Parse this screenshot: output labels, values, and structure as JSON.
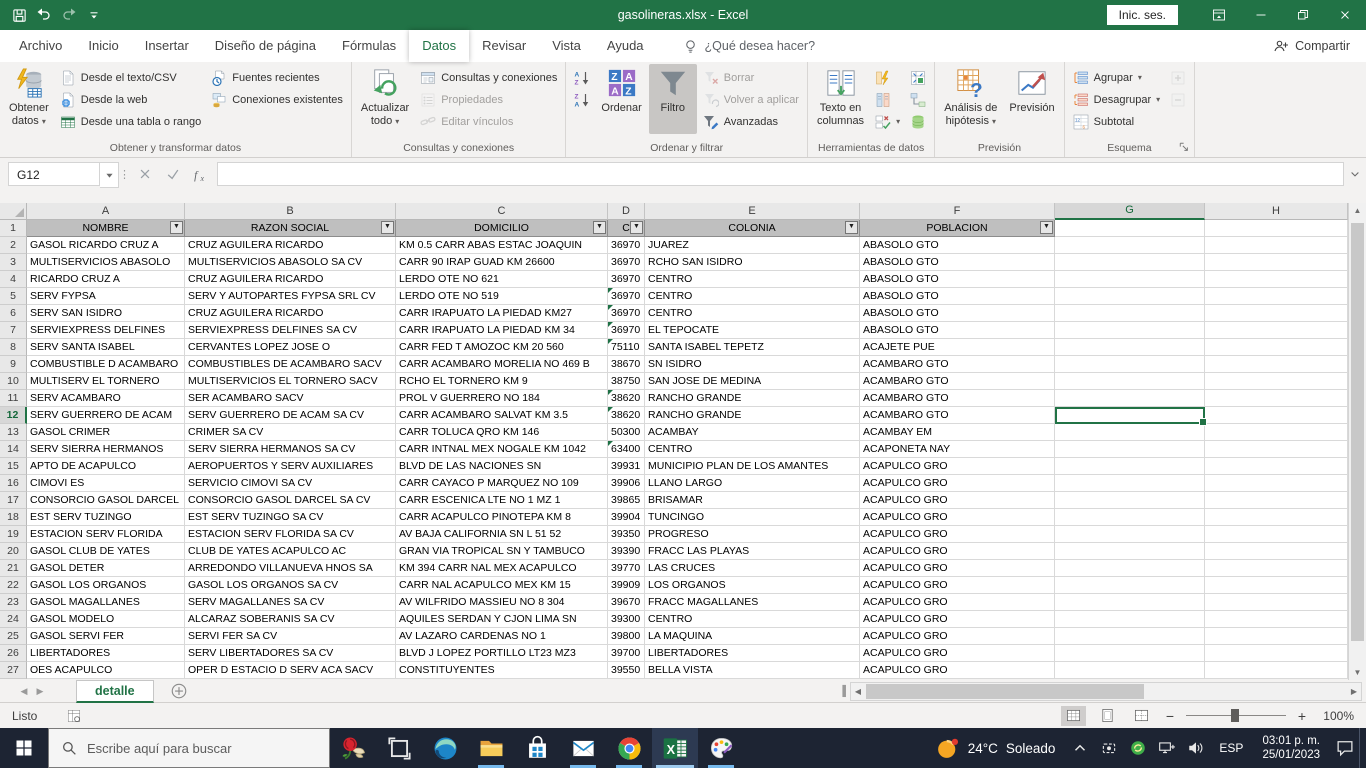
{
  "titlebar": {
    "title": "gasolineras.xlsx  -  Excel",
    "sign_in": "Inic. ses."
  },
  "menu": {
    "tabs": [
      "Archivo",
      "Inicio",
      "Insertar",
      "Diseño de página",
      "Fórmulas",
      "Datos",
      "Revisar",
      "Vista",
      "Ayuda"
    ],
    "active_tab": "Datos",
    "search_hint": "¿Qué desea hacer?",
    "share_label": "Compartir"
  },
  "ribbon": {
    "groups": [
      {
        "label": "Obtener y transformar datos",
        "cells": [
          {
            "type": "big",
            "lines": [
              "Obtener",
              "datos"
            ],
            "icon": "get-data-icon",
            "arrow": true
          },
          {
            "type": "stack",
            "items": [
              {
                "label": "Desde el texto/CSV",
                "icon": "from-text-csv-icon"
              },
              {
                "label": "Desde la web",
                "icon": "from-web-icon"
              },
              {
                "label": "Desde una tabla o rango",
                "icon": "from-table-icon"
              }
            ]
          },
          {
            "type": "stack",
            "items": [
              {
                "label": "Fuentes recientes",
                "icon": "recent-sources-icon"
              },
              {
                "label": "Conexiones existentes",
                "icon": "existing-connections-icon"
              }
            ]
          }
        ]
      },
      {
        "label": "Consultas y conexiones",
        "cells": [
          {
            "type": "big",
            "lines": [
              "Actualizar",
              "todo"
            ],
            "icon": "refresh-all-icon",
            "arrow": true
          },
          {
            "type": "stack",
            "items": [
              {
                "label": "Consultas y conexiones",
                "icon": "queries-connections-icon"
              },
              {
                "label": "Propiedades",
                "icon": "properties-icon",
                "disabled": true
              },
              {
                "label": "Editar vínculos",
                "icon": "edit-links-icon",
                "disabled": true
              }
            ]
          }
        ]
      },
      {
        "label": "Ordenar y filtrar",
        "cells": [
          {
            "type": "stack",
            "items": [
              {
                "label": "",
                "icon": "sort-az-icon"
              },
              {
                "label": "",
                "icon": "sort-za-icon"
              }
            ]
          },
          {
            "type": "big",
            "lines": [
              "Ordenar"
            ],
            "icon": "sort-dialog-icon"
          },
          {
            "type": "big",
            "lines": [
              "Filtro"
            ],
            "icon": "filter-icon",
            "active": true
          },
          {
            "type": "stack",
            "items": [
              {
                "label": "Borrar",
                "icon": "clear-filter-icon",
                "disabled": true
              },
              {
                "label": "Volver a aplicar",
                "icon": "reapply-filter-icon",
                "disabled": true
              },
              {
                "label": "Avanzadas",
                "icon": "advanced-filter-icon"
              }
            ]
          }
        ]
      },
      {
        "label": "Herramientas de datos",
        "cells": [
          {
            "type": "big",
            "lines": [
              "Texto en",
              "columnas"
            ],
            "icon": "text-to-columns-icon"
          },
          {
            "type": "stack",
            "items": [
              {
                "label": "",
                "icon": "flash-fill-icon"
              },
              {
                "label": "",
                "icon": "remove-duplicates-icon"
              },
              {
                "label": "",
                "icon": "data-validation-icon",
                "arrow": true
              }
            ]
          },
          {
            "type": "stack",
            "items": [
              {
                "label": "",
                "icon": "consolidate-icon"
              },
              {
                "label": "",
                "icon": "relationships-icon"
              },
              {
                "label": "",
                "icon": "data-model-icon"
              }
            ]
          }
        ]
      },
      {
        "label": "Previsión",
        "cells": [
          {
            "type": "big",
            "lines": [
              "Análisis de",
              "hipótesis"
            ],
            "icon": "what-if-icon",
            "arrow": true
          },
          {
            "type": "big",
            "lines": [
              "Previsión"
            ],
            "icon": "forecast-sheet-icon"
          }
        ]
      },
      {
        "label": "Esquema",
        "launcher": true,
        "cells": [
          {
            "type": "stack",
            "items": [
              {
                "label": "Agrupar",
                "icon": "group-icon",
                "arrow": true
              },
              {
                "label": "Desagrupar",
                "icon": "ungroup-icon",
                "arrow": true
              },
              {
                "label": "Subtotal",
                "icon": "subtotal-icon"
              }
            ]
          },
          {
            "type": "stack",
            "items": [
              {
                "label": "",
                "icon": "show-detail-icon",
                "disabled": true
              },
              {
                "label": "",
                "icon": "hide-detail-icon",
                "disabled": true
              }
            ]
          }
        ]
      }
    ]
  },
  "formula_bar": {
    "name_box": "G12",
    "formula": ""
  },
  "grid": {
    "columns": [
      "A",
      "B",
      "C",
      "D",
      "E",
      "F",
      "G",
      "H"
    ],
    "header_labels": [
      "NOMBRE",
      "RAZON SOCIAL",
      "DOMICILIO",
      "C",
      "COLONIA",
      "POBLACION"
    ],
    "selection": {
      "active_cell": "G12",
      "selected_row": 12,
      "selected_column": "G"
    },
    "green_triangle_rows": [
      5,
      6,
      7,
      8,
      11,
      12,
      14
    ],
    "rows": [
      [
        "GASOL RICARDO CRUZ A",
        "CRUZ AGUILERA RICARDO",
        "KM 0.5 CARR ABAS ESTAC JOAQUIN",
        "36970",
        "JUAREZ",
        "ABASOLO GTO"
      ],
      [
        "MULTISERVICIOS ABASOLO",
        "MULTISERVICIOS ABASOLO SA CV",
        "CARR 90 IRAP GUAD KM 26600",
        "36970",
        "RCHO SAN ISIDRO",
        "ABASOLO GTO"
      ],
      [
        "RICARDO CRUZ A",
        "CRUZ AGUILERA RICARDO",
        "LERDO OTE NO 621",
        "36970",
        "CENTRO",
        "ABASOLO GTO"
      ],
      [
        "SERV FYPSA",
        "SERV Y AUTOPARTES FYPSA SRL CV",
        "LERDO OTE NO 519",
        "36970",
        "CENTRO",
        "ABASOLO GTO"
      ],
      [
        "SERV SAN ISIDRO",
        "CRUZ AGUILERA RICARDO",
        "CARR IRAPUATO LA PIEDAD KM27",
        "36970",
        "CENTRO",
        "ABASOLO GTO"
      ],
      [
        "SERVIEXPRESS DELFINES",
        "SERVIEXPRESS DELFINES SA CV",
        "CARR IRAPUATO LA PIEDAD KM 34",
        "36970",
        "EL TEPOCATE",
        "ABASOLO GTO"
      ],
      [
        "SERV SANTA ISABEL",
        "CERVANTES LOPEZ JOSE O",
        "CARR FED T AMOZOC  KM 20 560",
        "75110",
        "SANTA ISABEL TEPETZ",
        "ACAJETE PUE"
      ],
      [
        "COMBUSTIBLE D ACAMBARO",
        "COMBUSTIBLES DE ACAMBARO SACV",
        "CARR ACAMBARO MORELIA NO 469 B",
        "38670",
        "SN ISIDRO",
        "ACAMBARO GTO"
      ],
      [
        "MULTISERV EL TORNERO",
        "MULTISERVICIOS EL TORNERO SACV",
        "RCHO EL TORNERO KM 9",
        "38750",
        "SAN JOSE DE MEDINA",
        "ACAMBARO GTO"
      ],
      [
        "SERV ACAMBARO",
        "SER ACAMBARO SACV",
        "PROL V GUERRERO NO 184",
        "38620",
        "RANCHO GRANDE",
        "ACAMBARO GTO"
      ],
      [
        "SERV GUERRERO DE ACAM",
        "SERV GUERRERO DE ACAM SA CV",
        "CARR ACAMBARO SALVAT KM 3.5",
        "38620",
        "RANCHO GRANDE",
        "ACAMBARO GTO"
      ],
      [
        "GASOL CRIMER",
        "CRIMER SA CV",
        "CARR TOLUCA QRO KM 146",
        "50300",
        "ACAMBAY",
        "ACAMBAY EM"
      ],
      [
        "SERV SIERRA HERMANOS",
        "SERV SIERRA HERMANOS SA CV",
        "CARR INTNAL MEX NOGALE KM 1042",
        "63400",
        "CENTRO",
        "ACAPONETA NAY"
      ],
      [
        "APTO DE ACAPULCO",
        "AEROPUERTOS Y SERV AUXILIARES",
        "BLVD DE LAS NACIONES SN",
        "39931",
        "MUNICIPIO PLAN DE LOS AMANTES",
        "ACAPULCO GRO"
      ],
      [
        "CIMOVI ES",
        "SERVICIO CIMOVI SA CV",
        "CARR CAYACO P MARQUEZ NO 109",
        "39906",
        "LLANO LARGO",
        "ACAPULCO GRO"
      ],
      [
        "CONSORCIO GASOL DARCEL",
        "CONSORCIO GASOL DARCEL SA CV",
        "CARR ESCENICA LTE NO 1 MZ 1",
        "39865",
        "BRISAMAR",
        "ACAPULCO GRO"
      ],
      [
        "EST SERV TUZINGO",
        "EST SERV TUZINGO SA CV",
        "CARR ACAPULCO PINOTEPA KM 8",
        "39904",
        "TUNCINGO",
        "ACAPULCO GRO"
      ],
      [
        "ESTACION SERV FLORIDA",
        "ESTACION SERV FLORIDA SA CV",
        "AV BAJA CALIFORNIA SN L 51 52",
        "39350",
        "PROGRESO",
        "ACAPULCO GRO"
      ],
      [
        "GASOL CLUB DE YATES",
        "CLUB DE YATES ACAPULCO AC",
        "GRAN VIA TROPICAL SN Y TAMBUCO",
        "39390",
        "FRACC LAS PLAYAS",
        "ACAPULCO GRO"
      ],
      [
        "GASOL DETER",
        "ARREDONDO VILLANUEVA HNOS SA",
        "KM 394 CARR NAL MEX ACAPULCO",
        "39770",
        "LAS CRUCES",
        "ACAPULCO GRO"
      ],
      [
        "GASOL LOS ORGANOS",
        "GASOL LOS ORGANOS SA CV",
        "CARR NAL ACAPULCO  MEX KM 15",
        "39909",
        "LOS ORGANOS",
        "ACAPULCO GRO"
      ],
      [
        "GASOL MAGALLANES",
        "SERV MAGALLANES SA CV",
        "AV WILFRIDO MASSIEU NO 8 304",
        "39670",
        "FRACC MAGALLANES",
        "ACAPULCO GRO"
      ],
      [
        "GASOL MODELO",
        "ALCARAZ SOBERANIS SA CV",
        "AQUILES SERDAN Y CJON LIMA SN",
        "39300",
        "CENTRO",
        "ACAPULCO GRO"
      ],
      [
        "GASOL SERVI FER",
        "SERVI FER SA CV",
        "AV LAZARO CARDENAS NO 1",
        "39800",
        "LA MAQUINA",
        "ACAPULCO GRO"
      ],
      [
        "LIBERTADORES",
        "SERV LIBERTADORES SA CV",
        "BLVD J LOPEZ PORTILLO LT23 MZ3",
        "39700",
        "LIBERTADORES",
        "ACAPULCO GRO"
      ],
      [
        "OES ACAPULCO",
        "OPER D ESTACIO D SERV ACA SACV",
        "CONSTITUYENTES",
        "39550",
        "BELLA VISTA",
        "ACAPULCO GRO"
      ]
    ]
  },
  "sheet_bar": {
    "active_sheet": "detalle"
  },
  "status_bar": {
    "mode": "Listo",
    "zoom": "100%"
  },
  "taskbar": {
    "search_placeholder": "Escribe aquí para buscar",
    "apps": [
      {
        "icon": "rose-shortcut-icon"
      },
      {
        "icon": "task-view-icon"
      },
      {
        "icon": "edge-icon"
      },
      {
        "icon": "file-explorer-icon",
        "running": true
      },
      {
        "icon": "store-icon"
      },
      {
        "icon": "mail-icon",
        "running": true
      },
      {
        "icon": "chrome-icon",
        "running": true
      },
      {
        "icon": "excel-icon",
        "running": true,
        "active": true
      },
      {
        "icon": "paint-icon",
        "running": true
      }
    ],
    "tray_icons": [
      "chevron-up-icon",
      "screen-clip-icon",
      "green-status-icon",
      "display-network-icon",
      "speaker-icon"
    ],
    "weather_temp": "24°C",
    "weather_desc": "Soleado",
    "language": "ESP",
    "time": "03:01 p. m.",
    "date": "25/01/2023"
  },
  "colors": {
    "accent_green": "#217346",
    "taskbar_bg": "#1d2433",
    "table_header_fill": "#bfbfbf",
    "running_indicator": "#76b9ed"
  }
}
